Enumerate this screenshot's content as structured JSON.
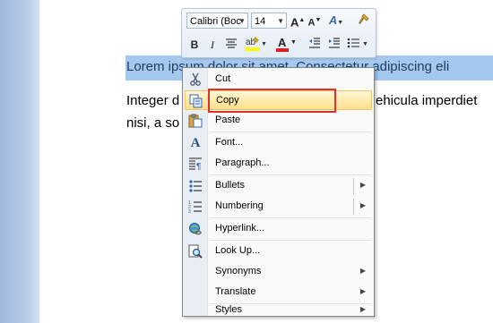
{
  "document": {
    "line1": "Lorem ipsum dolor sit amet. Consectetur adipiscing eli",
    "line2_start": "Integer d",
    "line2_end": "ehicula imperdiet",
    "line3": "nisi, a so"
  },
  "mini_toolbar": {
    "font_name": "Calibri (Boc",
    "font_size": "14",
    "grow_font": "A",
    "shrink_font": "A",
    "styles": "A",
    "bold": "B",
    "italic": "I",
    "font_color": "A"
  },
  "context_menu": {
    "items": [
      {
        "label": "Cut",
        "icon": "scissors-icon"
      },
      {
        "label": "Copy",
        "icon": "copy-icon"
      },
      {
        "label": "Paste",
        "icon": "paste-icon"
      },
      {
        "label": "Font...",
        "icon": "font-icon"
      },
      {
        "label": "Paragraph...",
        "icon": "paragraph-icon"
      },
      {
        "label": "Bullets",
        "icon": "bullets-icon"
      },
      {
        "label": "Numbering",
        "icon": "numbering-icon"
      },
      {
        "label": "Hyperlink...",
        "icon": "hyperlink-icon"
      },
      {
        "label": "Look Up...",
        "icon": "lookup-icon"
      },
      {
        "label": "Synonyms"
      },
      {
        "label": "Translate"
      },
      {
        "label": "Styles"
      }
    ],
    "hovered_item": "Copy"
  },
  "colors": {
    "selection": "#a5c8ef",
    "hover": "#ffe08a",
    "highlight_box": "#e03030",
    "font_color_bar": "#e02020",
    "highlighter_bar": "#ffff00"
  }
}
